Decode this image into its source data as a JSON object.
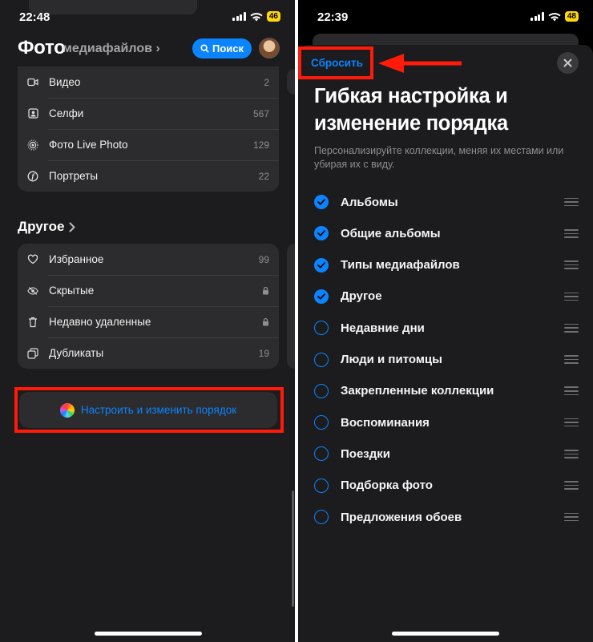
{
  "left_screen": {
    "status": {
      "time": "22:48",
      "battery": "46"
    },
    "header": {
      "title": "Фото",
      "ghost_subtitle": "медиафайлов",
      "search_label": "Поиск"
    },
    "media_types": [
      {
        "label": "Видео",
        "count": "2",
        "icon": "video-icon"
      },
      {
        "label": "Селфи",
        "count": "567",
        "icon": "selfie-icon"
      },
      {
        "label": "Фото Live Photo",
        "count": "129",
        "icon": "live-photo-icon"
      },
      {
        "label": "Портреты",
        "count": "22",
        "icon": "portrait-icon"
      }
    ],
    "other_section": {
      "title": "Другое",
      "items": [
        {
          "label": "Избранное",
          "count": "99",
          "icon": "heart-icon"
        },
        {
          "label": "Скрытые",
          "count": "",
          "icon": "eye-slash-icon",
          "locked": true
        },
        {
          "label": "Недавно удаленные",
          "count": "",
          "icon": "trash-icon",
          "locked": true
        },
        {
          "label": "Дубликаты",
          "count": "19",
          "icon": "duplicate-icon"
        }
      ]
    },
    "customize_button": "Настроить и изменить порядок"
  },
  "right_screen": {
    "status": {
      "time": "22:39",
      "battery": "48"
    },
    "reset_label": "Сбросить",
    "title": "Гибкая настройка и изменение порядка",
    "subtitle": "Персонализируйте коллекции, меняя их местами или убирая их с виду.",
    "options": [
      {
        "label": "Альбомы",
        "checked": true
      },
      {
        "label": "Общие альбомы",
        "checked": true
      },
      {
        "label": "Типы медиафайлов",
        "checked": true
      },
      {
        "label": "Другое",
        "checked": true
      },
      {
        "label": "Недавние дни",
        "checked": false
      },
      {
        "label": "Люди и питомцы",
        "checked": false
      },
      {
        "label": "Закрепленные коллекции",
        "checked": false
      },
      {
        "label": "Воспоминания",
        "checked": false
      },
      {
        "label": "Поездки",
        "checked": false
      },
      {
        "label": "Подборка фото",
        "checked": false
      },
      {
        "label": "Предложения обоев",
        "checked": false
      }
    ]
  },
  "colors": {
    "accent": "#0a84ff",
    "highlight": "#ff1a0a",
    "battery": "#ffd60a"
  }
}
